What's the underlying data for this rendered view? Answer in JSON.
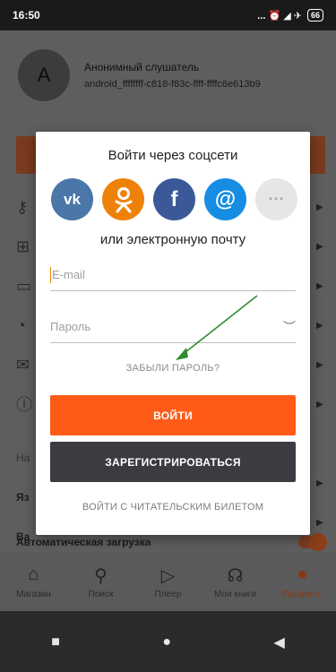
{
  "status": {
    "time": "16:50",
    "icons": "... ⏰ ◢ ✈",
    "battery": "66"
  },
  "profile": {
    "avatar_letter": "A",
    "name": "Анонимный слушатель",
    "id": "android_ffffffff-c818-f83c-ffff-ffffc6e613b9"
  },
  "settings": {
    "row1": "Яз",
    "row2": "Ва",
    "row0": "На",
    "autoload_label": "Автоматическая загрузка"
  },
  "tabs": [
    {
      "label": "Магазин"
    },
    {
      "label": "Поиск"
    },
    {
      "label": "Плеер"
    },
    {
      "label": "Мои книги"
    },
    {
      "label": "Профиль"
    }
  ],
  "dialog": {
    "title": "Войти через соцсети",
    "or_label": "или электронную почту",
    "email_placeholder": "E-mail",
    "password_placeholder": "Пароль",
    "forgot": "ЗАБЫЛИ ПАРОЛЬ?",
    "login_button": "ВОЙТИ",
    "register_button": "ЗАРЕГИСТРИРОВАТЬСЯ",
    "reader_link": "ВОЙТИ С ЧИТАТЕЛЬСКИМ БИЛЕТОМ",
    "socials": [
      "vk",
      "ok",
      "f",
      "@",
      "···"
    ]
  },
  "colors": {
    "accent": "#ff5a17",
    "dark_button": "#3e3a42",
    "arrow": "#2e8b2e"
  }
}
